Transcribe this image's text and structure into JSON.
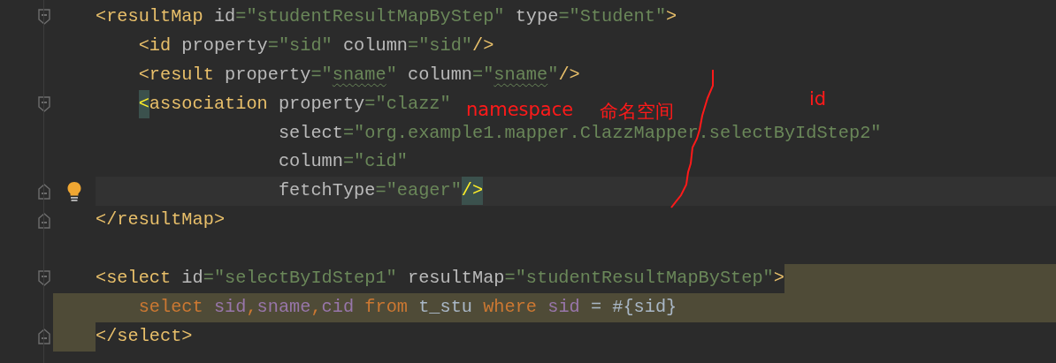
{
  "editor": {
    "lines": [
      {
        "selected": false,
        "fold_open": true,
        "tokens": [
          {
            "kind": "tag",
            "text": "<resultMap"
          },
          {
            "kind": "attr",
            "text": " id"
          },
          {
            "kind": "punct",
            "text": "="
          },
          {
            "kind": "string",
            "text": "\"studentResultMapByStep\""
          },
          {
            "kind": "attr",
            "text": " type"
          },
          {
            "kind": "punct",
            "text": "="
          },
          {
            "kind": "string",
            "text": "\"Student\""
          },
          {
            "kind": "tag",
            "text": ">"
          }
        ]
      },
      {
        "selected": false,
        "tokens": [
          {
            "kind": "tag",
            "text": "    <id"
          },
          {
            "kind": "attr",
            "text": " property"
          },
          {
            "kind": "punct",
            "text": "="
          },
          {
            "kind": "string",
            "text": "\"sid\""
          },
          {
            "kind": "attr",
            "text": " column"
          },
          {
            "kind": "punct",
            "text": "="
          },
          {
            "kind": "string",
            "text": "\"sid\""
          },
          {
            "kind": "tag",
            "text": "/>"
          }
        ]
      },
      {
        "selected": false,
        "tokens": [
          {
            "kind": "tag",
            "text": "    <result"
          },
          {
            "kind": "attr",
            "text": " property"
          },
          {
            "kind": "punct",
            "text": "="
          },
          {
            "kind": "string",
            "text": "\""
          },
          {
            "kind": "string",
            "text": "sname",
            "typo": true
          },
          {
            "kind": "string",
            "text": "\""
          },
          {
            "kind": "attr",
            "text": " column"
          },
          {
            "kind": "punct",
            "text": "="
          },
          {
            "kind": "string",
            "text": "\""
          },
          {
            "kind": "string",
            "text": "sname",
            "typo": true
          },
          {
            "kind": "string",
            "text": "\""
          },
          {
            "kind": "tag",
            "text": "/>"
          }
        ]
      },
      {
        "selected": false,
        "fold_open": true,
        "tokens": [
          {
            "kind": "tag",
            "text": "    <",
            "matched": true
          },
          {
            "kind": "tag",
            "text": "association"
          },
          {
            "kind": "attr",
            "text": " property"
          },
          {
            "kind": "punct",
            "text": "="
          },
          {
            "kind": "string",
            "text": "\"clazz\""
          }
        ]
      },
      {
        "selected": false,
        "tokens": [
          {
            "kind": "attr",
            "text": "                 select"
          },
          {
            "kind": "punct",
            "text": "="
          },
          {
            "kind": "string",
            "text": "\"org.example1.mapper.ClazzMapper.selectByIdStep2\""
          }
        ]
      },
      {
        "selected": false,
        "tokens": [
          {
            "kind": "attr",
            "text": "                 column"
          },
          {
            "kind": "punct",
            "text": "="
          },
          {
            "kind": "string",
            "text": "\"cid\""
          }
        ]
      },
      {
        "selected": false,
        "fold_close": true,
        "bulb": true,
        "current": true,
        "tokens": [
          {
            "kind": "attr",
            "text": "                 fetchType"
          },
          {
            "kind": "punct",
            "text": "="
          },
          {
            "kind": "string",
            "text": "\"eager\""
          },
          {
            "kind": "tag",
            "text": "/>",
            "matched": true
          }
        ]
      },
      {
        "selected": false,
        "fold_close": true,
        "tokens": [
          {
            "kind": "tag",
            "text": "</resultMap>"
          }
        ]
      },
      {
        "selected": false
      },
      {
        "selected": true,
        "fold_open": true,
        "tokens": [
          {
            "kind": "tag",
            "text": "<select"
          },
          {
            "kind": "attr",
            "text": " id"
          },
          {
            "kind": "punct",
            "text": "="
          },
          {
            "kind": "string",
            "text": "\"selectByIdStep1\""
          },
          {
            "kind": "attr",
            "text": " resultMap"
          },
          {
            "kind": "punct",
            "text": "="
          },
          {
            "kind": "string",
            "text": "\"studentResultMapByStep\""
          },
          {
            "kind": "tag",
            "text": ">"
          }
        ]
      },
      {
        "selected": true,
        "tokens": [
          {
            "kind": "keyword",
            "text": "    select"
          },
          {
            "kind": "column",
            "text": " sid"
          },
          {
            "kind": "keyword",
            "text": ","
          },
          {
            "kind": "column",
            "text": "sname"
          },
          {
            "kind": "keyword",
            "text": ","
          },
          {
            "kind": "column",
            "text": "cid"
          },
          {
            "kind": "keyword",
            "text": " from"
          },
          {
            "kind": "plain",
            "text": " t_stu"
          },
          {
            "kind": "keyword",
            "text": " where"
          },
          {
            "kind": "column",
            "text": " sid"
          },
          {
            "kind": "plain",
            "text": " = #{sid}"
          }
        ]
      },
      {
        "selected": true,
        "fold_close": true,
        "tokens": [
          {
            "kind": "tag",
            "text": "</select>"
          }
        ]
      }
    ]
  },
  "annotations": [
    {
      "kind": "label",
      "text": "namespace"
    },
    {
      "kind": "label",
      "text": "命名空间"
    },
    {
      "kind": "label",
      "text": "id"
    },
    {
      "kind": "stroke"
    }
  ]
}
